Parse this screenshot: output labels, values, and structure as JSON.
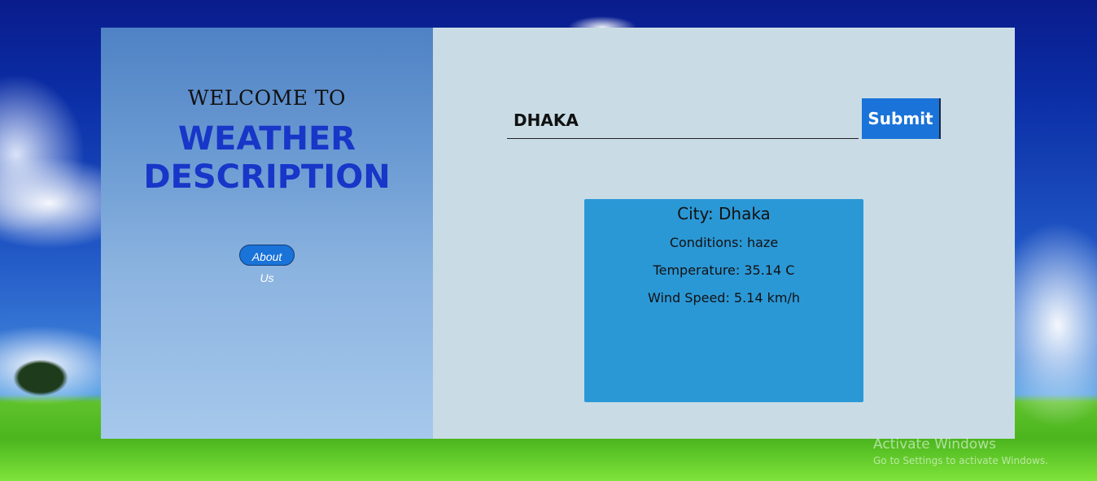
{
  "hero": {
    "welcome": "WELCOME TO",
    "title_line1": "WEATHER",
    "title_line2": "DESCRIPTION",
    "about_label": "About Us"
  },
  "search": {
    "value": "DHAKA",
    "submit_label": "Submit"
  },
  "result": {
    "city": "City: Dhaka",
    "conditions": "Conditions: haze",
    "temperature": "Temperature: 35.14 C",
    "wind": "Wind Speed: 5.14 km/h"
  },
  "watermark": {
    "title": "Activate Windows",
    "subtitle": "Go to Settings to activate Windows."
  },
  "colors": {
    "accent": "#1a73d8",
    "title": "#1836c8",
    "result_bg": "#2b98d6",
    "panel_bg": "#c9dce6"
  }
}
